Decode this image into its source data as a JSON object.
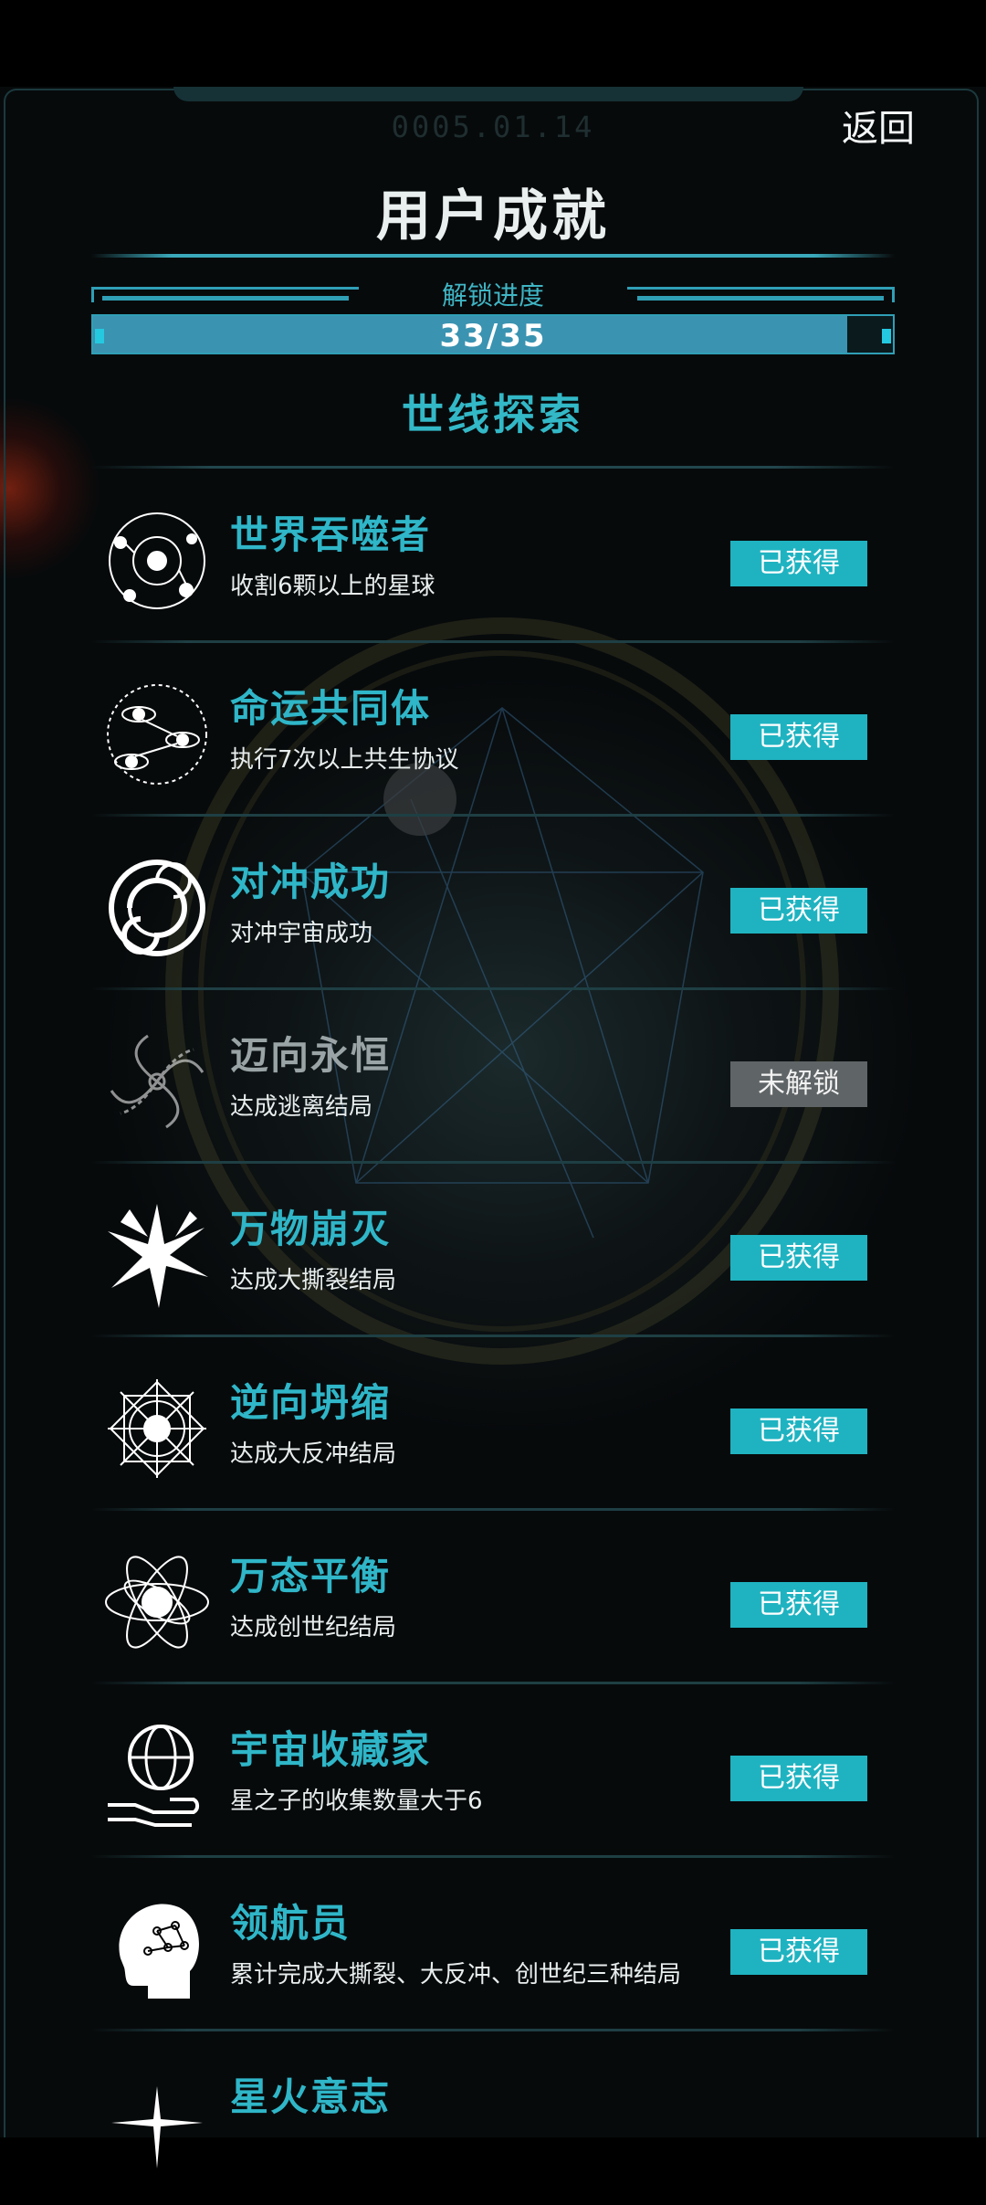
{
  "header": {
    "date": "0005.01.14",
    "back_label": "返回",
    "title": "用户成就"
  },
  "progress": {
    "label": "解锁进度",
    "text": "33/35",
    "value": 33,
    "max": 35,
    "fraction": 0.943
  },
  "section": {
    "title": "世线探索"
  },
  "achievements": [
    {
      "name": "世界吞噬者",
      "desc": "收割6颗以上的星球",
      "status": "已获得",
      "icon": "planet-orbit-icon",
      "locked": false
    },
    {
      "name": "命运共同体",
      "desc": "执行7次以上共生协议",
      "status": "已获得",
      "icon": "linked-planets-icon",
      "locked": false
    },
    {
      "name": "对冲成功",
      "desc": "对冲宇宙成功",
      "status": "已获得",
      "icon": "spiral-vortex-icon",
      "locked": false
    },
    {
      "name": "迈向永恒",
      "desc": "达成逃离结局",
      "status": "未解锁",
      "icon": "swirl-galaxy-icon",
      "locked": true
    },
    {
      "name": "万物崩灭",
      "desc": "达成大撕裂结局",
      "status": "已获得",
      "icon": "starburst-icon",
      "locked": false
    },
    {
      "name": "逆向坍缩",
      "desc": "达成大反冲结局",
      "status": "已获得",
      "icon": "mandala-icon",
      "locked": false
    },
    {
      "name": "万态平衡",
      "desc": "达成创世纪结局",
      "status": "已获得",
      "icon": "atom-orbit-icon",
      "locked": false
    },
    {
      "name": "宇宙收藏家",
      "desc": "星之子的收集数量大于6",
      "status": "已获得",
      "icon": "globe-hand-icon",
      "locked": false
    },
    {
      "name": "领航员",
      "desc": "累计完成大撕裂、大反冲、创世纪三种结局",
      "status": "已获得",
      "icon": "brain-head-icon",
      "locked": false
    },
    {
      "name": "星火意志",
      "desc": "",
      "status": "",
      "icon": "spark-icon",
      "locked": false
    }
  ],
  "colors": {
    "accent": "#2fb6c8",
    "badge_obtained": "#1fb3c1",
    "badge_locked": "#5f6466",
    "progress_fill": "#3a93b1"
  }
}
